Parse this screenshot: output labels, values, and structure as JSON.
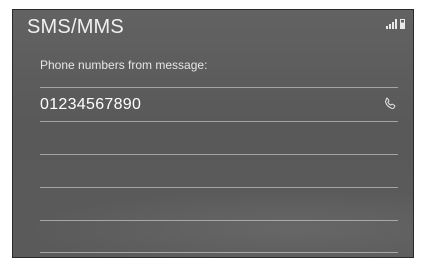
{
  "header": {
    "title": "SMS/MMS"
  },
  "section": {
    "label": "Phone numbers from message:"
  },
  "numbers": [
    {
      "number": "01234567890",
      "icon": "phone-icon"
    }
  ],
  "icons": {
    "signal": "signal-strength-icon",
    "battery": "battery-icon",
    "call": "phone-icon"
  },
  "colors": {
    "screen_bg": "#5c5c5c",
    "text": "#f2f2f2",
    "divider": "#d0d0d0"
  }
}
